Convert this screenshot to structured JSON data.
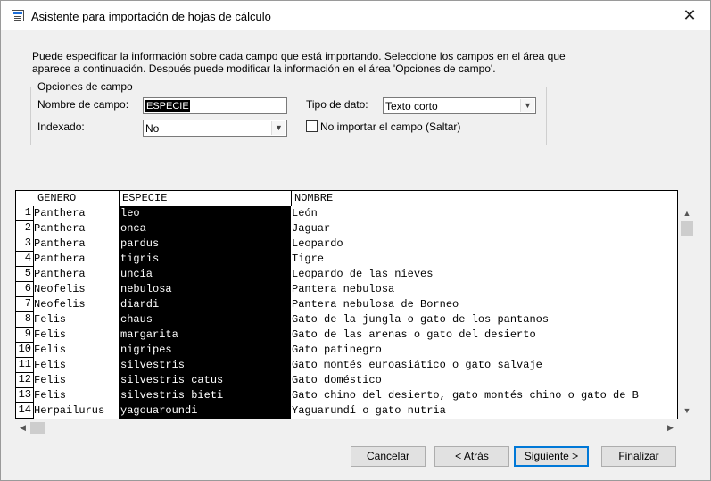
{
  "window": {
    "title": "Asistente para importación de hojas de cálculo",
    "close_glyph": "✕"
  },
  "intro": "Puede especificar la información sobre cada campo que está importando. Seleccione los campos en el área que aparece a continuación. Después puede modificar la información en el área 'Opciones de campo'.",
  "options": {
    "legend": "Opciones de campo",
    "field_name_label": "Nombre de campo:",
    "field_name_value": "ESPECIE",
    "data_type_label": "Tipo de dato:",
    "data_type_value": "Texto corto",
    "indexed_label": "Indexado:",
    "indexed_value": "No",
    "skip_label": "No importar el campo (Saltar)",
    "skip_checked": false
  },
  "table": {
    "columns": [
      "GENERO",
      "ESPECIE",
      "NOMBRE"
    ],
    "selected_column": "ESPECIE",
    "rows": [
      {
        "n": "1",
        "genero": "Panthera",
        "especie": "leo",
        "nombre": "León"
      },
      {
        "n": "2",
        "genero": "Panthera",
        "especie": "onca",
        "nombre": "Jaguar"
      },
      {
        "n": "3",
        "genero": "Panthera",
        "especie": "pardus",
        "nombre": "Leopardo"
      },
      {
        "n": "4",
        "genero": "Panthera",
        "especie": "tigris",
        "nombre": "Tigre"
      },
      {
        "n": "5",
        "genero": "Panthera",
        "especie": "uncia",
        "nombre": "Leopardo de las nieves"
      },
      {
        "n": "6",
        "genero": "Neofelis",
        "especie": "nebulosa",
        "nombre": "Pantera nebulosa"
      },
      {
        "n": "7",
        "genero": "Neofelis",
        "especie": "diardi",
        "nombre": "Pantera nebulosa de Borneo"
      },
      {
        "n": "8",
        "genero": "Felis",
        "especie": "chaus",
        "nombre": "Gato de la jungla o gato de los pantanos"
      },
      {
        "n": "9",
        "genero": "Felis",
        "especie": "margarita",
        "nombre": "Gato de las arenas o gato del desierto"
      },
      {
        "n": "10",
        "genero": "Felis",
        "especie": "nigripes",
        "nombre": "Gato patinegro"
      },
      {
        "n": "11",
        "genero": "Felis",
        "especie": "silvestris",
        "nombre": "Gato montés euroasiático o gato salvaje"
      },
      {
        "n": "12",
        "genero": "Felis",
        "especie": "silvestris catus",
        "nombre": "Gato doméstico"
      },
      {
        "n": "13",
        "genero": "Felis",
        "especie": "silvestris bieti",
        "nombre": "Gato chino del desierto, gato montés chino o gato de B"
      },
      {
        "n": "14",
        "genero": "Herpailurus",
        "especie": "yagouaroundi",
        "nombre": "Yaguarundí o gato nutria"
      }
    ]
  },
  "buttons": {
    "cancel": "Cancelar",
    "back": "< Atrás",
    "next": "Siguiente >",
    "finish": "Finalizar"
  },
  "icons": {
    "app": "spreadsheet-import-icon",
    "close": "close-icon",
    "combo": "chevron-down-icon"
  },
  "colors": {
    "selection": "#000000",
    "default_button_border": "#0078d7"
  }
}
